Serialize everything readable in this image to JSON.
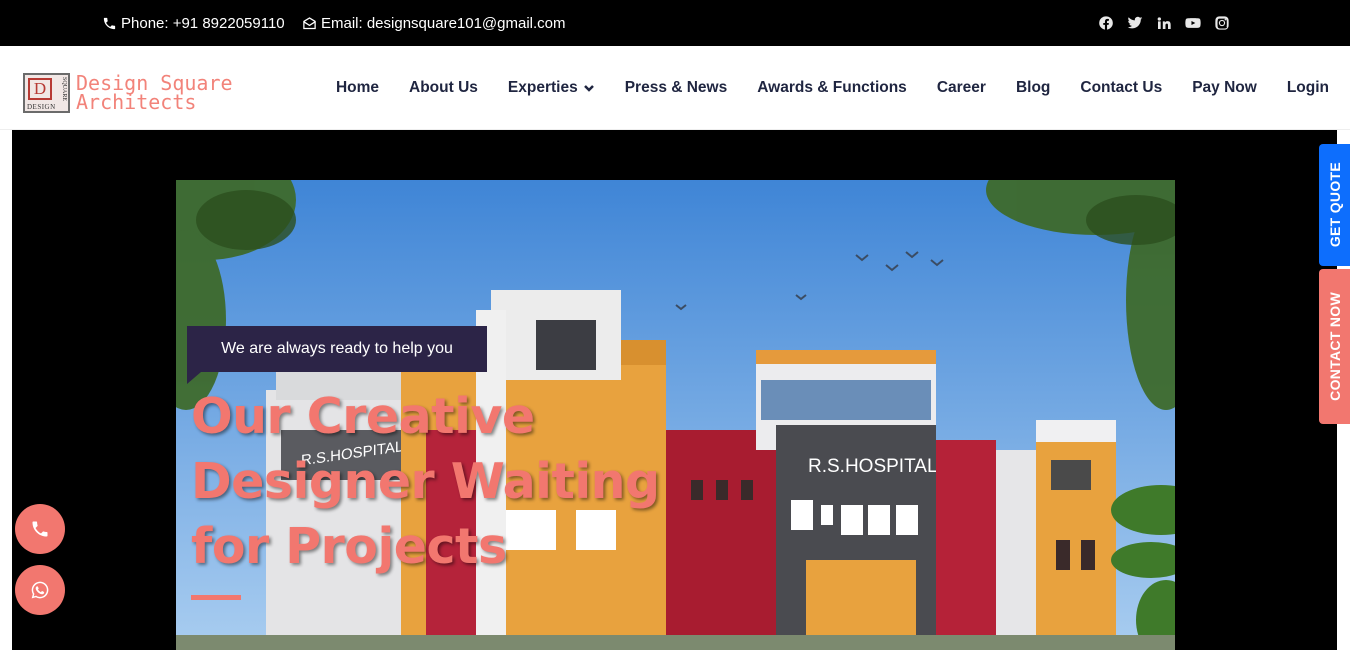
{
  "topbar": {
    "phone": "Phone: +91 8922059110",
    "email": "Email: designsquare101@gmail.com",
    "socials": [
      "facebook-icon",
      "twitter-icon",
      "linkedin-icon",
      "youtube-icon",
      "instagram-icon"
    ]
  },
  "logo": {
    "mark_letter": "D",
    "mark_word": "DESIGN",
    "mark_side": "SQUARE",
    "line1": "Design Square",
    "line2": "Architects"
  },
  "nav": {
    "items": [
      {
        "label": "Home"
      },
      {
        "label": "About Us"
      },
      {
        "label": "Experties"
      },
      {
        "label": "Press & News"
      },
      {
        "label": "Awards & Functions"
      },
      {
        "label": "Career"
      },
      {
        "label": "Blog"
      },
      {
        "label": "Contact Us"
      },
      {
        "label": "Pay Now"
      },
      {
        "label": "Login"
      }
    ]
  },
  "hero": {
    "tagline": "We are always ready to help you",
    "headline": [
      "Our Creative",
      "Designer Waiting",
      "for Projects"
    ],
    "sign_front": "R.S.HOSPITAL",
    "sign_left": "R.S.HOSPITAL"
  },
  "side_tabs": {
    "quote": "GET QUOTE",
    "contact": "CONTACT NOW"
  },
  "colors": {
    "accent": "#f2776f",
    "nav_text": "#1f2540",
    "quote_blue": "#0d6efd",
    "tagline_bg": "#2c2447"
  }
}
